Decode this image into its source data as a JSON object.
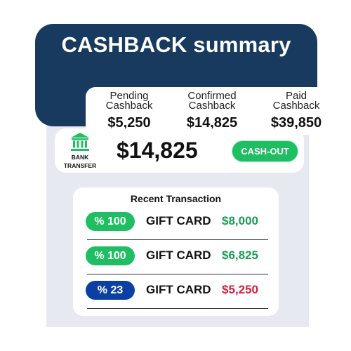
{
  "header": {
    "title": "CASHBACK summary",
    "bg_color": "#173a5e"
  },
  "stats": [
    {
      "label_line1": "Pending",
      "label_line2": "Cashback",
      "value": "$5,250"
    },
    {
      "label_line1": "Confirmed",
      "label_line2": "Cashback",
      "value": "$14,825"
    },
    {
      "label_line1": "Paid",
      "label_line2": "Cashback",
      "value": "$39,850"
    }
  ],
  "balance": {
    "bank_icon": "bank-building-icon",
    "bank_label_line1": "BANK",
    "bank_label_line2": "TRANSFER",
    "amount": "$14,825",
    "cashout_label": "CASH-OUT",
    "accent_color": "#1fbe63"
  },
  "recent": {
    "title": "Recent  Transaction",
    "rows": [
      {
        "badge": "% 100",
        "badge_color": "#1fbe63",
        "name": "GIFT CARD",
        "amount": "$8,000",
        "amount_color": "#1a9e55"
      },
      {
        "badge": "% 100",
        "badge_color": "#1fbe63",
        "name": "GIFT CARD",
        "amount": "$6,825",
        "amount_color": "#1a9e55"
      },
      {
        "badge": "% 23",
        "badge_color": "#0b3fa3",
        "name": "GIFT CARD",
        "amount": "$5,250",
        "amount_color": "#d81c3f"
      }
    ]
  }
}
